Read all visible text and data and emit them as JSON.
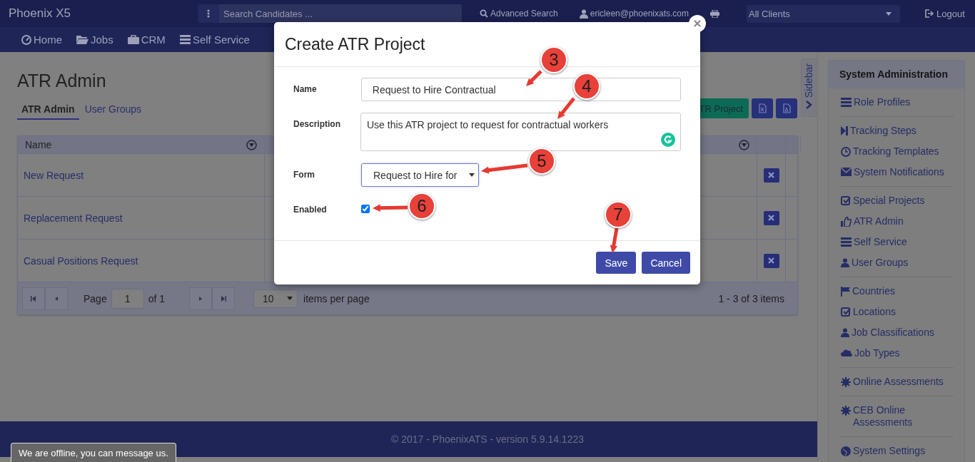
{
  "header": {
    "brand": "Phoenix X5",
    "search_placeholder": "Search Candidates ...",
    "advanced_search": "Advanced Search",
    "user": "ericleen@phoenixats.com",
    "client_select": "All Clients",
    "logout": "Logout"
  },
  "nav": [
    {
      "label": "Home"
    },
    {
      "label": "Jobs"
    },
    {
      "label": "CRM"
    },
    {
      "label": "Self Service"
    }
  ],
  "page": {
    "title": "ATR Admin",
    "tabs": [
      {
        "label": "ATR Admin",
        "selected": true
      },
      {
        "label": "User Groups",
        "selected": false
      }
    ],
    "add_button": "TR Project"
  },
  "table": {
    "columns": [
      "Name"
    ],
    "rows": [
      {
        "name": "New Request"
      },
      {
        "name": "Replacement Request"
      },
      {
        "name": "Casual Positions Request"
      }
    ],
    "pager": {
      "page_label": "Page",
      "page": "1",
      "of": "of 1",
      "page_size": "10",
      "per_page": "items per page",
      "summary": "1 - 3 of 3 items"
    }
  },
  "sidebar_toggle": "Sidebar",
  "sidebar": {
    "title": "System Administration",
    "groups": [
      [
        "Role Profiles"
      ],
      [
        "Tracking Steps",
        "Tracking Templates",
        "System Notifications"
      ],
      [
        "Special Projects",
        "ATR Admin",
        "Self Service",
        "User Groups"
      ],
      [
        "Countries",
        "Locations",
        "Job Classifications",
        "Job Types"
      ],
      [
        "Online Assessments"
      ],
      [
        "CEB Online Assessments"
      ],
      [
        "System Settings"
      ]
    ]
  },
  "footer": "© 2017 - PhoenixATS - version 5.9.14.1223",
  "chat": "We are offline, you can message us.",
  "dialog": {
    "title": "Create ATR Project",
    "fields": [
      {
        "kind": "text",
        "label": "Name",
        "value": "Request to Hire Contractual"
      },
      {
        "kind": "textarea",
        "label": "Description",
        "value": "Use this ATR project to request for contractual workers"
      },
      {
        "kind": "select",
        "label": "Form",
        "value": "Request to Hire for"
      },
      {
        "kind": "checkbox",
        "label": "Enabled",
        "checked": true
      }
    ],
    "buttons": [
      {
        "label": "Save",
        "kind": "primary"
      },
      {
        "label": "Cancel",
        "kind": "primary"
      }
    ]
  },
  "callouts": [
    {
      "number": "3"
    },
    {
      "number": "4"
    },
    {
      "number": "5"
    },
    {
      "number": "6"
    },
    {
      "number": "7"
    }
  ]
}
